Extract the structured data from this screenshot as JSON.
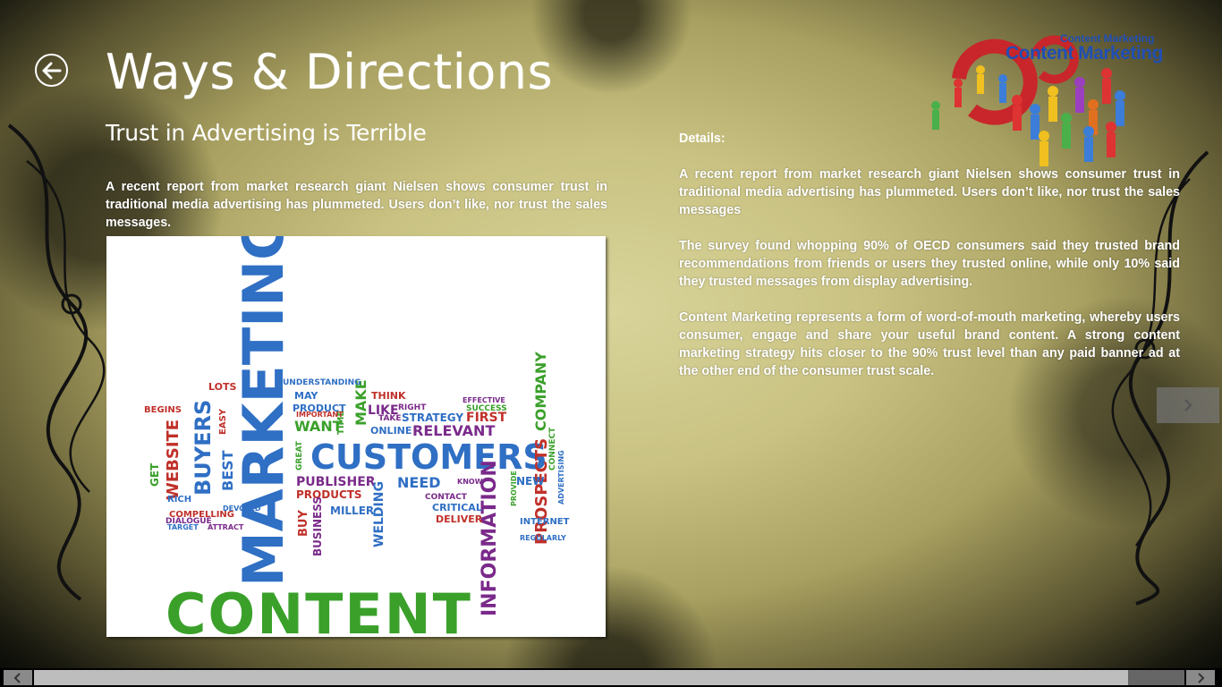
{
  "header": {
    "title": "Ways & Directions",
    "back_icon": "arrow-left-circle-icon"
  },
  "logo": {
    "line1": "Content Marketing",
    "line2": "Content Marketing",
    "icon": "magnet-people-icon"
  },
  "article": {
    "subtitle": "Trust in Advertising is Terrible",
    "intro": "A recent report from market research giant Nielsen shows consumer trust in traditional media advertising has plummeted. Users don’t like, nor trust the sales messages."
  },
  "details": {
    "label": "Details:",
    "paragraphs": [
      "A recent report from market research giant Nielsen shows consumer trust in traditional media advertising has plummeted. Users don’t like, nor trust the sales messages",
      "The survey found whopping 90% of OECD consumers said they trusted brand recommendations from friends or users they trusted online, while only 10% said they trusted messages from display advertising.",
      "Content Marketing represents a form of word-of-mouth marketing, whereby users consumer, engage and share your useful brand content. A strong content marketing strategy hits closer to the 90% trust level than any paid banner ad at the other end of the consumer trust scale."
    ]
  },
  "word_cloud": {
    "words": [
      "CONTENT",
      "MARKETING",
      "CUSTOMERS",
      "INFORMATION",
      "BUYERS",
      "WEBSITE",
      "PROSPECTS",
      "PUBLISHER",
      "PRODUCTS",
      "RELEVANT",
      "STRATEGY",
      "COMPANY",
      "NEED",
      "WANT",
      "MAKE",
      "LIKE",
      "FIRST",
      "BEST",
      "BUSINESS",
      "WELDING",
      "CRITICAL",
      "DELIVER",
      "INTERNET",
      "MILLER",
      "NEW",
      "ONLINE",
      "THINK",
      "LOTS",
      "MAY",
      "PRODUCT",
      "CONTACT",
      "COMPELLING",
      "REGULARLY",
      "UNDERSTANDING",
      "SUCCESS",
      "EFFECTIVE",
      "GET",
      "EASY",
      "GREAT",
      "BUY",
      "TIME",
      "RIGHT",
      "TAKE",
      "IMPORTANT",
      "DIALOGUE",
      "RICH",
      "BEGINS",
      "TARGET",
      "ATTRACT",
      "DEVOTED",
      "PROVIDE",
      "KNOW",
      "ADVERTISING",
      "CONNECT"
    ]
  },
  "navigation": {
    "next_icon": "chevron-right-icon"
  },
  "scrollbar": {
    "left_icon": "scroll-left-icon",
    "right_icon": "scroll-right-icon",
    "position": 0.0,
    "visible_fraction": 0.95
  },
  "colors": {
    "text": "#ffffff",
    "logo_blue": "#1f4fb5",
    "wc_green": "#3aa02a",
    "wc_blue": "#2f6fc4",
    "wc_purple": "#7a2a8a",
    "wc_red": "#c0302a"
  }
}
